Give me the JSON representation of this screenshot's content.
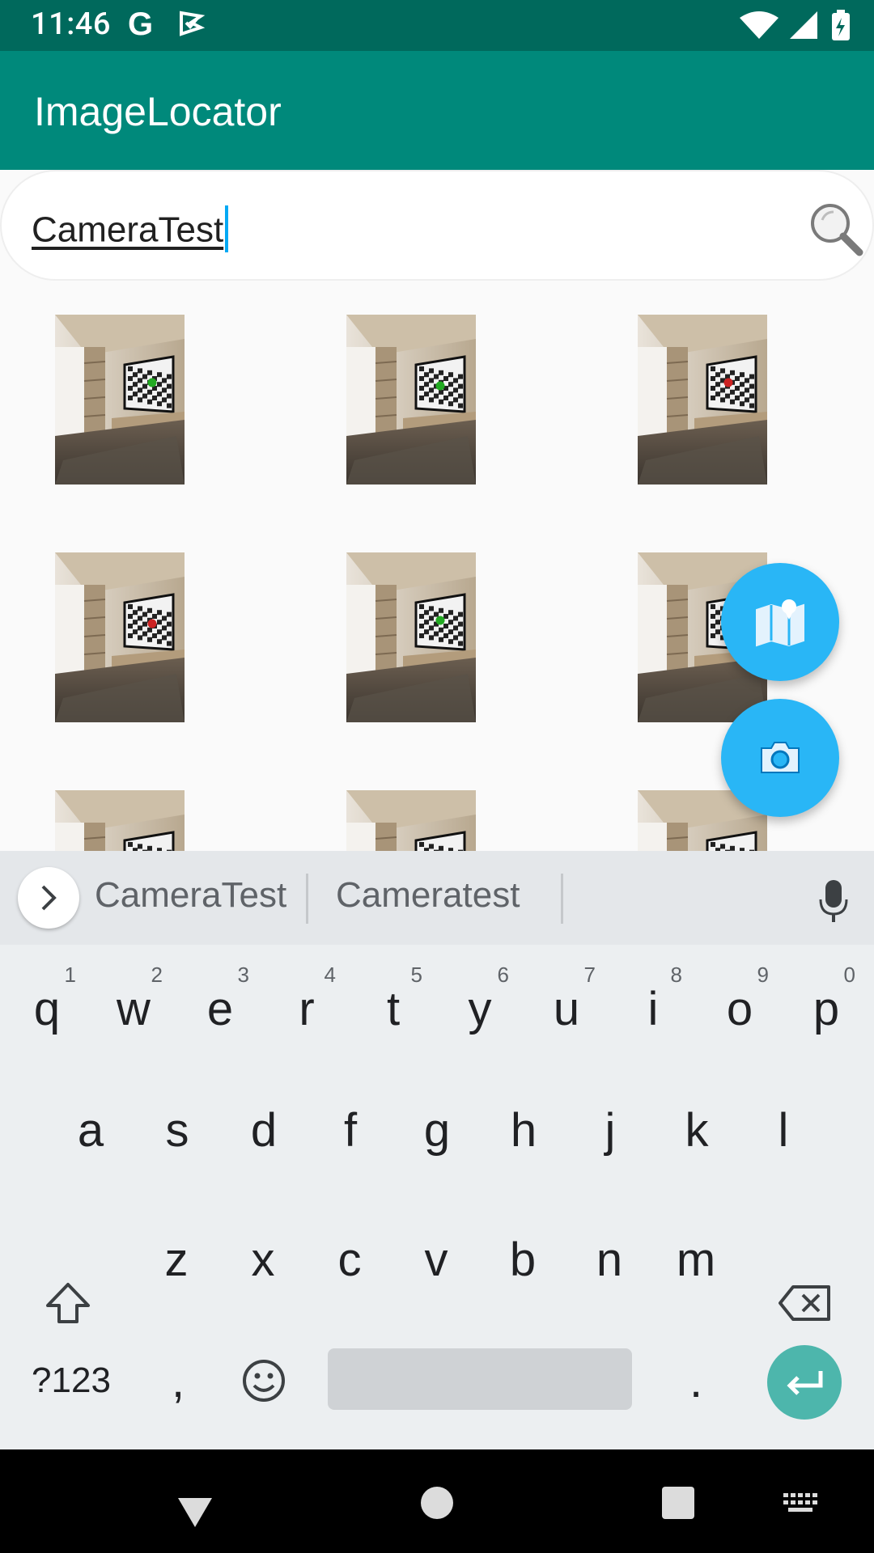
{
  "status_bar": {
    "time": "11:46",
    "g_label": "G"
  },
  "app_bar": {
    "title": "ImageLocator"
  },
  "search": {
    "value": "CameraTest"
  },
  "grid": {
    "thumbnails": [
      {
        "marker": "#22aa22"
      },
      {
        "marker": "#22aa22"
      },
      {
        "marker": "#cc2222"
      },
      {
        "marker": "#cc2222"
      },
      {
        "marker": "#22aa22"
      },
      {
        "marker": "#cc2222"
      },
      {
        "marker": "#22aa22"
      },
      {
        "marker": "#cc2222"
      },
      {
        "marker": "#cc2222"
      }
    ]
  },
  "fabs": {
    "map_icon": "map-icon",
    "camera_icon": "camera-icon"
  },
  "keyboard": {
    "suggestions": [
      "CameraTest",
      "Cameratest"
    ],
    "row1": [
      "q",
      "w",
      "e",
      "r",
      "t",
      "y",
      "u",
      "i",
      "o",
      "p"
    ],
    "row1_hints": [
      "1",
      "2",
      "3",
      "4",
      "5",
      "6",
      "7",
      "8",
      "9",
      "0"
    ],
    "row2": [
      "a",
      "s",
      "d",
      "f",
      "g",
      "h",
      "j",
      "k",
      "l"
    ],
    "row3": [
      "z",
      "x",
      "c",
      "v",
      "b",
      "n",
      "m"
    ],
    "symbols_label": "?123",
    "comma_label": ",",
    "period_label": "."
  },
  "colors": {
    "status_bar": "#00695c",
    "app_bar": "#00897b",
    "fab": "#29b6f6",
    "enter": "#4db6ac"
  }
}
